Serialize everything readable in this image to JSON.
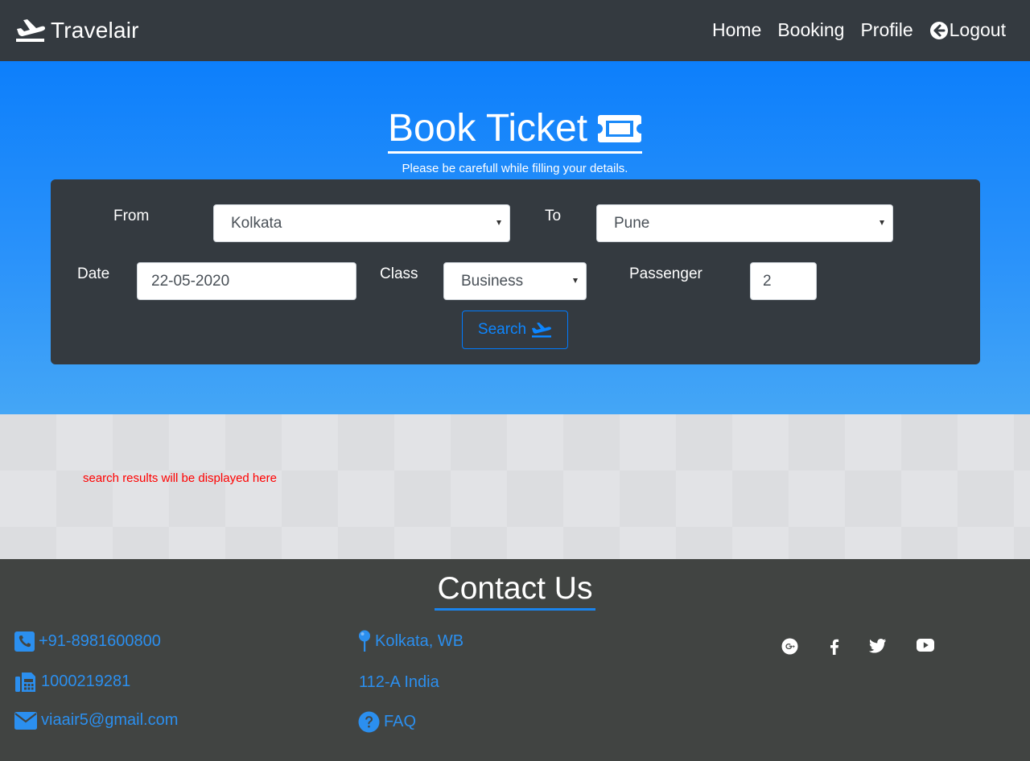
{
  "navbar": {
    "brand": "Travelair",
    "brand_icon": "plane-departure-icon",
    "links": [
      "Home",
      "Booking",
      "Profile",
      "Logout"
    ],
    "logout_icon": "arrow-circle-left-icon"
  },
  "hero": {
    "title": "Book Ticket",
    "title_icon": "ticket-icon",
    "subtitle": "Please be carefull while filling your details."
  },
  "form": {
    "from_label": "From",
    "from_value": "Kolkata",
    "to_label": "To",
    "to_value": "Pune",
    "date_label": "Date",
    "date_value": "22-05-2020",
    "class_label": "Class",
    "class_value": "Business",
    "passenger_label": "Passenger",
    "passenger_value": "2",
    "search_label": "Search"
  },
  "results": {
    "placeholder": "search results will be displayed here"
  },
  "footer": {
    "title": "Contact Us",
    "phone": "+91-8981600800",
    "fax": "1000219281",
    "email": "viaair5@gmail.com",
    "location": "Kolkata, WB",
    "address": "112-A India",
    "faq": "FAQ",
    "social": [
      "google-plus-icon",
      "facebook-icon",
      "twitter-icon",
      "youtube-icon"
    ]
  },
  "colors": {
    "navbar_bg": "#343a40",
    "hero_top": "#0d7ffb",
    "hero_bottom": "#44a6f6",
    "accent": "#007bff",
    "footer_bg": "#414442",
    "footer_link": "#2b8fef",
    "results_text": "#ff0000"
  }
}
